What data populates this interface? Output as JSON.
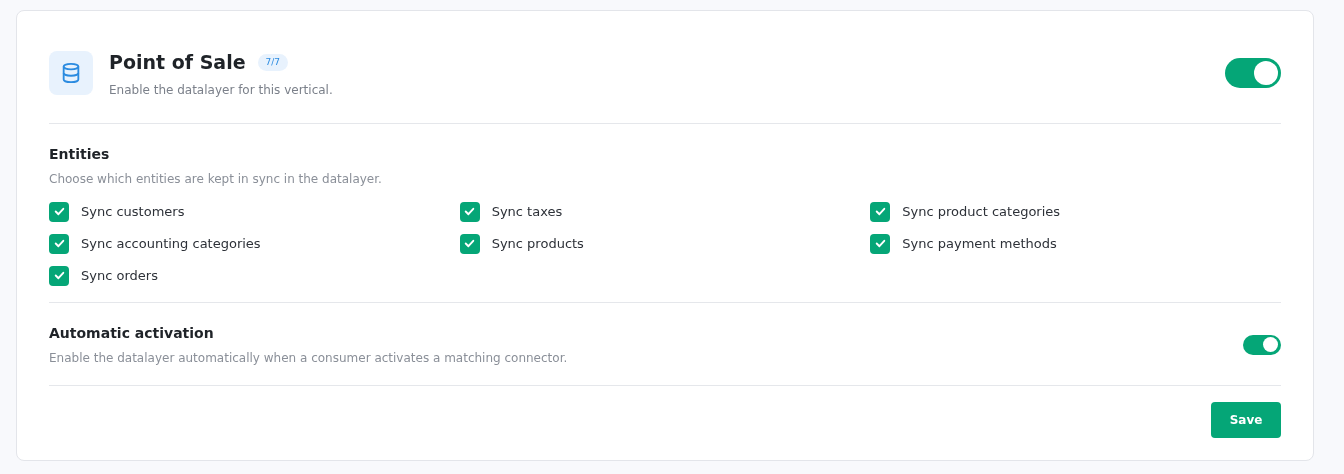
{
  "header": {
    "title": "Point of Sale",
    "badge": "7/7",
    "description": "Enable the datalayer for this vertical.",
    "enabled": true
  },
  "entities": {
    "title": "Entities",
    "description": "Choose which entities are kept in sync in the datalayer.",
    "items": [
      {
        "label": "Sync customers",
        "checked": true
      },
      {
        "label": "Sync taxes",
        "checked": true
      },
      {
        "label": "Sync product categories",
        "checked": true
      },
      {
        "label": "Sync accounting categories",
        "checked": true
      },
      {
        "label": "Sync products",
        "checked": true
      },
      {
        "label": "Sync payment methods",
        "checked": true
      },
      {
        "label": "Sync orders",
        "checked": true
      }
    ]
  },
  "automatic_activation": {
    "title": "Automatic activation",
    "description": "Enable the datalayer automatically when a consumer activates a matching connector.",
    "on": true
  },
  "save_button": "Save"
}
